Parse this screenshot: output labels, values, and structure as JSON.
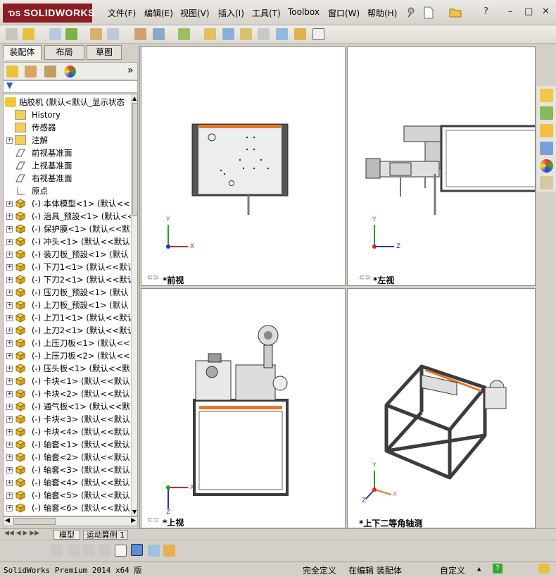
{
  "app": {
    "logo_text": "SOLIDWORKS"
  },
  "menu": [
    {
      "label": "文件(F)"
    },
    {
      "label": "编辑(E)"
    },
    {
      "label": "视图(V)"
    },
    {
      "label": "插入(I)"
    },
    {
      "label": "工具(T)"
    },
    {
      "label": "Toolbox"
    },
    {
      "label": "窗口(W)"
    },
    {
      "label": "帮助(H)"
    }
  ],
  "window_controls": {
    "minimize": "–",
    "restore": "□",
    "close": "✕",
    "help": "?"
  },
  "left_tabs": {
    "tab1": "装配体",
    "tab2": "布局",
    "tab3": "草图"
  },
  "tree": {
    "root": "贴胶机  (默认<默认_显示状态",
    "items": [
      {
        "label": "History",
        "expand": ""
      },
      {
        "label": "传感器",
        "expand": ""
      },
      {
        "label": "注解",
        "expand": "+"
      },
      {
        "label": "前视基准面",
        "expand": ""
      },
      {
        "label": "上视基准面",
        "expand": ""
      },
      {
        "label": "右视基准面",
        "expand": ""
      },
      {
        "label": "原点",
        "expand": ""
      },
      {
        "label": "(-) 本体模型<1> (默认<<",
        "expand": "+"
      },
      {
        "label": "(-) 治具_预設<1> (默认<<",
        "expand": "+"
      },
      {
        "label": "(-) 保护膜<1> (默认<<默",
        "expand": "+"
      },
      {
        "label": "(-) 冲头<1> (默认<<默认",
        "expand": "+"
      },
      {
        "label": "(-) 装刀板_预設<1> (默认",
        "expand": "+"
      },
      {
        "label": "(-) 下刀1<1> (默认<<默认",
        "expand": "+"
      },
      {
        "label": "(-) 下刀2<1> (默认<<默认",
        "expand": "+"
      },
      {
        "label": "(-) 压刀板_预設<1> (默认",
        "expand": "+"
      },
      {
        "label": "(-) 上刀板_预設<1> (默认",
        "expand": "+"
      },
      {
        "label": "(-) 上刀1<1> (默认<<默认",
        "expand": "+"
      },
      {
        "label": "(-) 上刀2<1> (默认<<默认",
        "expand": "+"
      },
      {
        "label": "(-) 上压刀板<1> (默认<<",
        "expand": "+"
      },
      {
        "label": "(-) 上压刀板<2> (默认<<",
        "expand": "+"
      },
      {
        "label": "(-) 压头板<1> (默认<<默",
        "expand": "+"
      },
      {
        "label": "(-) 卡块<1> (默认<<默认",
        "expand": "+"
      },
      {
        "label": "(-) 卡块<2> (默认<<默认",
        "expand": "+"
      },
      {
        "label": "(-) 通气板<1> (默认<<默",
        "expand": "+"
      },
      {
        "label": "(-) 卡块<3> (默认<<默认",
        "expand": "+"
      },
      {
        "label": "(-) 卡块<4> (默认<<默认",
        "expand": "+"
      },
      {
        "label": "(-) 轴套<1> (默认<<默认",
        "expand": "+"
      },
      {
        "label": "(-) 轴套<2> (默认<<默认",
        "expand": "+"
      },
      {
        "label": "(-) 轴套<3> (默认<<默认",
        "expand": "+"
      },
      {
        "label": "(-) 轴套<4> (默认<<默认",
        "expand": "+"
      },
      {
        "label": "(-) 轴套<5> (默认<<默认",
        "expand": "+"
      },
      {
        "label": "(-) 轴套<6> (默认<<默认",
        "expand": "+"
      }
    ]
  },
  "viewports": {
    "front": "*前视",
    "left": "*左视",
    "top": "*上视",
    "iso": "*上下二等角轴测"
  },
  "axes": {
    "x": "X",
    "y": "Y",
    "z": "Z"
  },
  "bottom_tabs": {
    "model": "模型",
    "motion": "运动算例 1"
  },
  "status": {
    "version": "SolidWorks Premium 2014 x64 版",
    "defined": "完全定义",
    "editing": "在编辑 装配体",
    "units": "自定义",
    "units_arrow": "▲"
  },
  "colors": {
    "accent": "#e87722",
    "brand": "#8b1e24",
    "frame": "#3c3c3c"
  }
}
